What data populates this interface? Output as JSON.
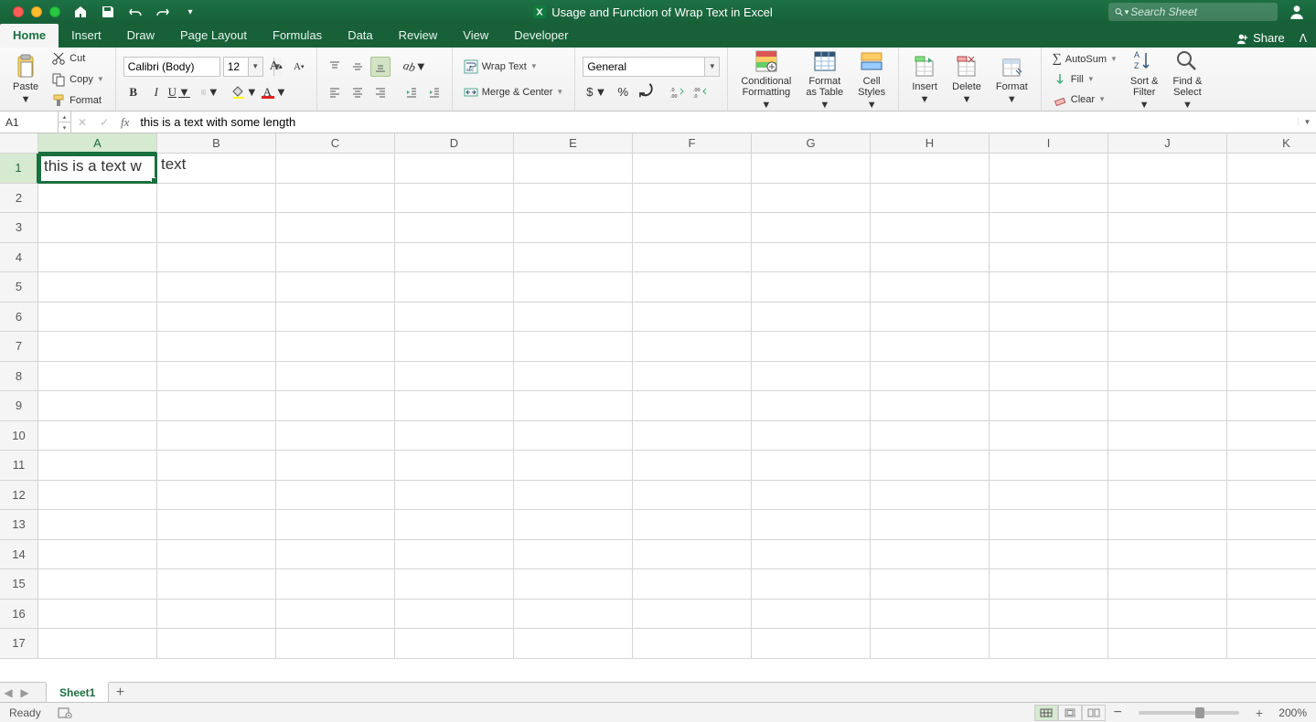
{
  "title": "Usage and Function of Wrap Text in Excel",
  "search_placeholder": "Search Sheet",
  "tabs": {
    "items": [
      "Home",
      "Insert",
      "Draw",
      "Page Layout",
      "Formulas",
      "Data",
      "Review",
      "View",
      "Developer"
    ],
    "active": "Home",
    "share": "Share"
  },
  "clipboard": {
    "paste": "Paste",
    "cut": "Cut",
    "copy": "Copy",
    "format": "Format"
  },
  "font": {
    "name": "Calibri (Body)",
    "size": "12",
    "bold": "B",
    "italic": "I",
    "underline": "U"
  },
  "alignment": {
    "wrap": "Wrap Text",
    "merge": "Merge & Center"
  },
  "number": {
    "format": "General"
  },
  "styles": {
    "cond": "Conditional\nFormatting",
    "table": "Format\nas Table",
    "cell": "Cell\nStyles"
  },
  "cells": {
    "insert": "Insert",
    "delete": "Delete",
    "format": "Format"
  },
  "editing": {
    "autosum": "AutoSum",
    "fill": "Fill",
    "clear": "Clear",
    "sort": "Sort &\nFilter",
    "find": "Find &\nSelect"
  },
  "name_box": "A1",
  "formula": "this is a text with some length",
  "columns": [
    "A",
    "B",
    "C",
    "D",
    "E",
    "F",
    "G",
    "H",
    "I",
    "J",
    "K"
  ],
  "row_count": 17,
  "cells_data": {
    "A1": "this is a text w",
    "B1": "text"
  },
  "active_cell": "A1",
  "sheet_tab": "Sheet1",
  "status_text": "Ready",
  "zoom": "200%"
}
